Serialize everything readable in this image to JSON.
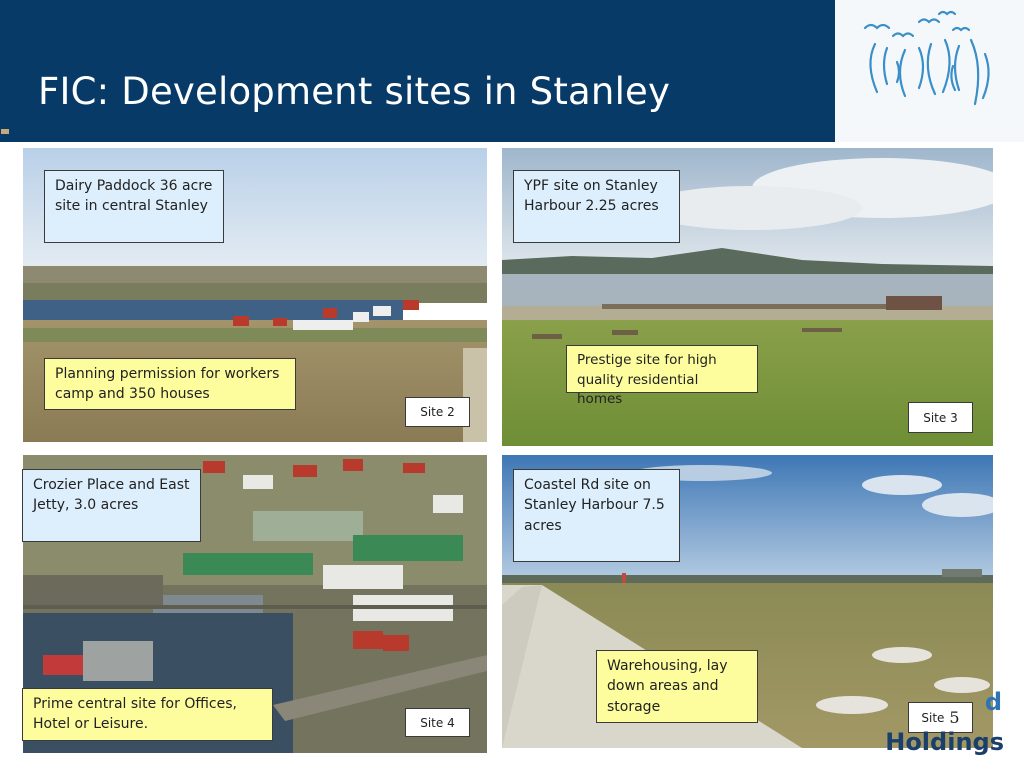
{
  "slide": {
    "title": "FIC: Development sites in Stanley",
    "brand_partial_1": "d",
    "brand_partial_2": "Holdings"
  },
  "colors": {
    "header": "#083a67",
    "blue_label": "#ddeffd",
    "yellow_label": "#fdfd9e",
    "logo_birds": "#3a8fc9"
  },
  "icons": {
    "logo": "birds-logo-icon"
  },
  "sites": [
    {
      "description": "Dairy Paddock 36 acre site in central Stanley",
      "highlight": "Planning permission for workers camp and 350 houses",
      "site_prefix": "Site",
      "site_number": "2"
    },
    {
      "description": "YPF site on Stanley Harbour 2.25 acres",
      "highlight": "Prestige site for high quality residential homes",
      "site_prefix": "Site",
      "site_number": "3"
    },
    {
      "description": "Crozier Place and East Jetty, 3.0 acres",
      "highlight": "Prime central site for Offices, Hotel or Leisure.",
      "site_prefix": "Site",
      "site_number": "4"
    },
    {
      "description": "Coastel Rd site on Stanley Harbour 7.5 acres",
      "highlight": "Warehousing, lay down areas and storage",
      "site_prefix": "Site",
      "site_number": "5"
    }
  ]
}
